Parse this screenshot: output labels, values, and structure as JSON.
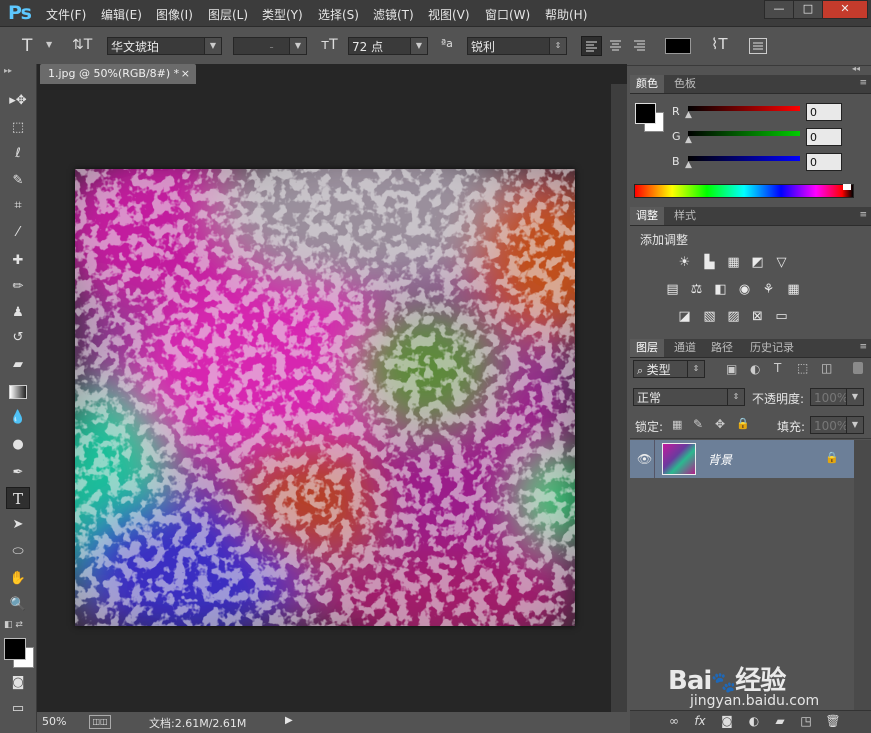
{
  "app": {
    "logo": "Ps"
  },
  "menu": [
    "文件(F)",
    "编辑(E)",
    "图像(I)",
    "图层(L)",
    "类型(Y)",
    "选择(S)",
    "滤镜(T)",
    "视图(V)",
    "窗口(W)",
    "帮助(H)"
  ],
  "window_buttons": {
    "minimize": "—",
    "maximize": "□",
    "close": "✕"
  },
  "options": {
    "tool_glyph": "T",
    "font_family": "华文琥珀",
    "font_style": "-",
    "font_size": "72 点",
    "aa_label": "ªa",
    "antialias": "锐利",
    "text_color": "#000000"
  },
  "document": {
    "tab_title": "1.jpg @ 50%(RGB/8#) *",
    "tab_close": "×",
    "zoom": "50%",
    "doc_info": "文档:2.61M/2.61M"
  },
  "color_panel": {
    "tabs": [
      "颜色",
      "色板"
    ],
    "channels": [
      {
        "label": "R",
        "value": "0",
        "color": "#ff0000"
      },
      {
        "label": "G",
        "value": "0",
        "color": "#00cc00"
      },
      {
        "label": "B",
        "value": "0",
        "color": "#0000ff"
      }
    ],
    "foreground": "#000000",
    "background": "#ffffff"
  },
  "adjust_panel": {
    "tabs": [
      "调整",
      "样式"
    ],
    "title": "添加调整"
  },
  "layers_panel": {
    "tabs": [
      "图层",
      "通道",
      "路径",
      "历史记录"
    ],
    "filter_label": "类型",
    "blend_mode": "正常",
    "opacity_label": "不透明度:",
    "opacity_value": "100%",
    "lock_label": "锁定:",
    "fill_label": "填充:",
    "fill_value": "100%",
    "layers": [
      {
        "name": "背景",
        "visible": true,
        "locked": true
      }
    ]
  },
  "watermark": {
    "brand": "Bai",
    "brand2": "经验",
    "url": "jingyan.baidu.com"
  }
}
